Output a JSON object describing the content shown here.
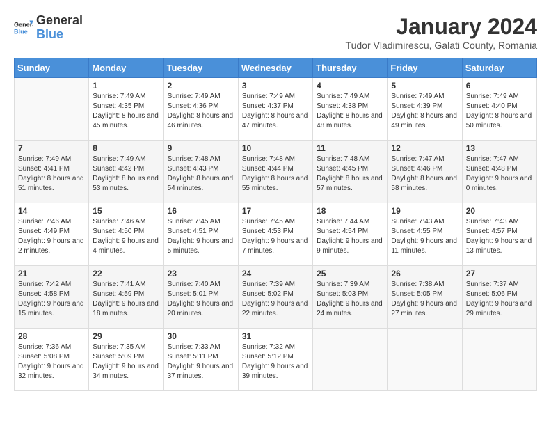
{
  "logo": {
    "text_general": "General",
    "text_blue": "Blue"
  },
  "header": {
    "month_year": "January 2024",
    "location": "Tudor Vladimirescu, Galati County, Romania"
  },
  "weekdays": [
    "Sunday",
    "Monday",
    "Tuesday",
    "Wednesday",
    "Thursday",
    "Friday",
    "Saturday"
  ],
  "weeks": [
    [
      {
        "day": "",
        "sunrise": "",
        "sunset": "",
        "daylight": ""
      },
      {
        "day": "1",
        "sunrise": "Sunrise: 7:49 AM",
        "sunset": "Sunset: 4:35 PM",
        "daylight": "Daylight: 8 hours and 45 minutes."
      },
      {
        "day": "2",
        "sunrise": "Sunrise: 7:49 AM",
        "sunset": "Sunset: 4:36 PM",
        "daylight": "Daylight: 8 hours and 46 minutes."
      },
      {
        "day": "3",
        "sunrise": "Sunrise: 7:49 AM",
        "sunset": "Sunset: 4:37 PM",
        "daylight": "Daylight: 8 hours and 47 minutes."
      },
      {
        "day": "4",
        "sunrise": "Sunrise: 7:49 AM",
        "sunset": "Sunset: 4:38 PM",
        "daylight": "Daylight: 8 hours and 48 minutes."
      },
      {
        "day": "5",
        "sunrise": "Sunrise: 7:49 AM",
        "sunset": "Sunset: 4:39 PM",
        "daylight": "Daylight: 8 hours and 49 minutes."
      },
      {
        "day": "6",
        "sunrise": "Sunrise: 7:49 AM",
        "sunset": "Sunset: 4:40 PM",
        "daylight": "Daylight: 8 hours and 50 minutes."
      }
    ],
    [
      {
        "day": "7",
        "sunrise": "Sunrise: 7:49 AM",
        "sunset": "Sunset: 4:41 PM",
        "daylight": "Daylight: 8 hours and 51 minutes."
      },
      {
        "day": "8",
        "sunrise": "Sunrise: 7:49 AM",
        "sunset": "Sunset: 4:42 PM",
        "daylight": "Daylight: 8 hours and 53 minutes."
      },
      {
        "day": "9",
        "sunrise": "Sunrise: 7:48 AM",
        "sunset": "Sunset: 4:43 PM",
        "daylight": "Daylight: 8 hours and 54 minutes."
      },
      {
        "day": "10",
        "sunrise": "Sunrise: 7:48 AM",
        "sunset": "Sunset: 4:44 PM",
        "daylight": "Daylight: 8 hours and 55 minutes."
      },
      {
        "day": "11",
        "sunrise": "Sunrise: 7:48 AM",
        "sunset": "Sunset: 4:45 PM",
        "daylight": "Daylight: 8 hours and 57 minutes."
      },
      {
        "day": "12",
        "sunrise": "Sunrise: 7:47 AM",
        "sunset": "Sunset: 4:46 PM",
        "daylight": "Daylight: 8 hours and 58 minutes."
      },
      {
        "day": "13",
        "sunrise": "Sunrise: 7:47 AM",
        "sunset": "Sunset: 4:48 PM",
        "daylight": "Daylight: 9 hours and 0 minutes."
      }
    ],
    [
      {
        "day": "14",
        "sunrise": "Sunrise: 7:46 AM",
        "sunset": "Sunset: 4:49 PM",
        "daylight": "Daylight: 9 hours and 2 minutes."
      },
      {
        "day": "15",
        "sunrise": "Sunrise: 7:46 AM",
        "sunset": "Sunset: 4:50 PM",
        "daylight": "Daylight: 9 hours and 4 minutes."
      },
      {
        "day": "16",
        "sunrise": "Sunrise: 7:45 AM",
        "sunset": "Sunset: 4:51 PM",
        "daylight": "Daylight: 9 hours and 5 minutes."
      },
      {
        "day": "17",
        "sunrise": "Sunrise: 7:45 AM",
        "sunset": "Sunset: 4:53 PM",
        "daylight": "Daylight: 9 hours and 7 minutes."
      },
      {
        "day": "18",
        "sunrise": "Sunrise: 7:44 AM",
        "sunset": "Sunset: 4:54 PM",
        "daylight": "Daylight: 9 hours and 9 minutes."
      },
      {
        "day": "19",
        "sunrise": "Sunrise: 7:43 AM",
        "sunset": "Sunset: 4:55 PM",
        "daylight": "Daylight: 9 hours and 11 minutes."
      },
      {
        "day": "20",
        "sunrise": "Sunrise: 7:43 AM",
        "sunset": "Sunset: 4:57 PM",
        "daylight": "Daylight: 9 hours and 13 minutes."
      }
    ],
    [
      {
        "day": "21",
        "sunrise": "Sunrise: 7:42 AM",
        "sunset": "Sunset: 4:58 PM",
        "daylight": "Daylight: 9 hours and 15 minutes."
      },
      {
        "day": "22",
        "sunrise": "Sunrise: 7:41 AM",
        "sunset": "Sunset: 4:59 PM",
        "daylight": "Daylight: 9 hours and 18 minutes."
      },
      {
        "day": "23",
        "sunrise": "Sunrise: 7:40 AM",
        "sunset": "Sunset: 5:01 PM",
        "daylight": "Daylight: 9 hours and 20 minutes."
      },
      {
        "day": "24",
        "sunrise": "Sunrise: 7:39 AM",
        "sunset": "Sunset: 5:02 PM",
        "daylight": "Daylight: 9 hours and 22 minutes."
      },
      {
        "day": "25",
        "sunrise": "Sunrise: 7:39 AM",
        "sunset": "Sunset: 5:03 PM",
        "daylight": "Daylight: 9 hours and 24 minutes."
      },
      {
        "day": "26",
        "sunrise": "Sunrise: 7:38 AM",
        "sunset": "Sunset: 5:05 PM",
        "daylight": "Daylight: 9 hours and 27 minutes."
      },
      {
        "day": "27",
        "sunrise": "Sunrise: 7:37 AM",
        "sunset": "Sunset: 5:06 PM",
        "daylight": "Daylight: 9 hours and 29 minutes."
      }
    ],
    [
      {
        "day": "28",
        "sunrise": "Sunrise: 7:36 AM",
        "sunset": "Sunset: 5:08 PM",
        "daylight": "Daylight: 9 hours and 32 minutes."
      },
      {
        "day": "29",
        "sunrise": "Sunrise: 7:35 AM",
        "sunset": "Sunset: 5:09 PM",
        "daylight": "Daylight: 9 hours and 34 minutes."
      },
      {
        "day": "30",
        "sunrise": "Sunrise: 7:33 AM",
        "sunset": "Sunset: 5:11 PM",
        "daylight": "Daylight: 9 hours and 37 minutes."
      },
      {
        "day": "31",
        "sunrise": "Sunrise: 7:32 AM",
        "sunset": "Sunset: 5:12 PM",
        "daylight": "Daylight: 9 hours and 39 minutes."
      },
      {
        "day": "",
        "sunrise": "",
        "sunset": "",
        "daylight": ""
      },
      {
        "day": "",
        "sunrise": "",
        "sunset": "",
        "daylight": ""
      },
      {
        "day": "",
        "sunrise": "",
        "sunset": "",
        "daylight": ""
      }
    ]
  ]
}
